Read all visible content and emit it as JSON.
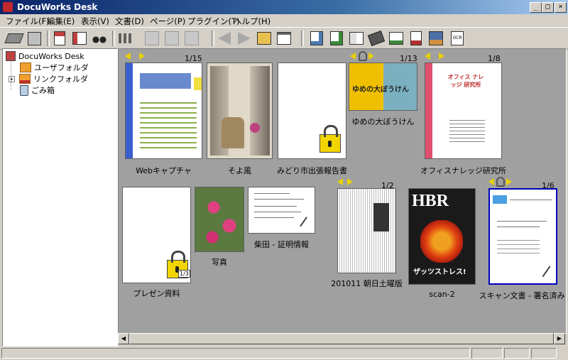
{
  "window": {
    "title": "DocuWorks Desk"
  },
  "window_controls": {
    "minimize": "_",
    "maximize": "□",
    "close": "×"
  },
  "menu": [
    "ファイル(F)",
    "編集(E)",
    "表示(V)",
    "文書(D)",
    "ページ(P)",
    "プラグイン(T)",
    "ヘルプ(H)"
  ],
  "tree": {
    "root": "DocuWorks Desk",
    "items": [
      "ユーザフォルダ",
      "リンクフォルダ",
      "ごみ箱"
    ]
  },
  "documents": [
    {
      "label": "Webキャプチャ",
      "pages": "1/15"
    },
    {
      "label": "そよ風"
    },
    {
      "label": "みどり市出張報告書"
    },
    {
      "label": "ゆめの大ぼうけん",
      "pages": "1/13",
      "cover_text": "ゆめの大ぼうけん"
    },
    {
      "label": "オフィスナレッジ研究所",
      "pages": "1/8",
      "cover_text": "オフィス ナレッジ 研究所"
    },
    {
      "label": "プレゼン資料",
      "badge": "1/3"
    },
    {
      "label": "写真"
    },
    {
      "label": "柴田 - 証明情報"
    },
    {
      "label": "201011 朝日土曜版",
      "pages": "1/2"
    },
    {
      "label": "scan-2",
      "cover_text": "HBR",
      "cover_sub": "ザッツストレス!"
    },
    {
      "label": "スキャン文書 - 署名済み",
      "pages": "1/6"
    }
  ],
  "toolbar_icons": [
    "open-tray-icon",
    "box-icon",
    "upload-icon",
    "layout-icon",
    "binoculars-icon",
    "grid-view-icon",
    "stack-icon",
    "unstack-icon",
    "merge-icon",
    "back-icon",
    "forward-icon",
    "folder-up-icon",
    "properties-icon",
    "viewer-icon",
    "print-icon",
    "split-icon",
    "stapler-icon",
    "send-icon",
    "annotate-icon",
    "photo-icon",
    "ocr-icon"
  ],
  "colors": {
    "title_start": "#0a246a",
    "workspace_bg": "#a0a0a0",
    "binder_blue": "#3a5fcd",
    "binder_pink": "#e05070",
    "arrow_yellow": "#e8d000"
  }
}
